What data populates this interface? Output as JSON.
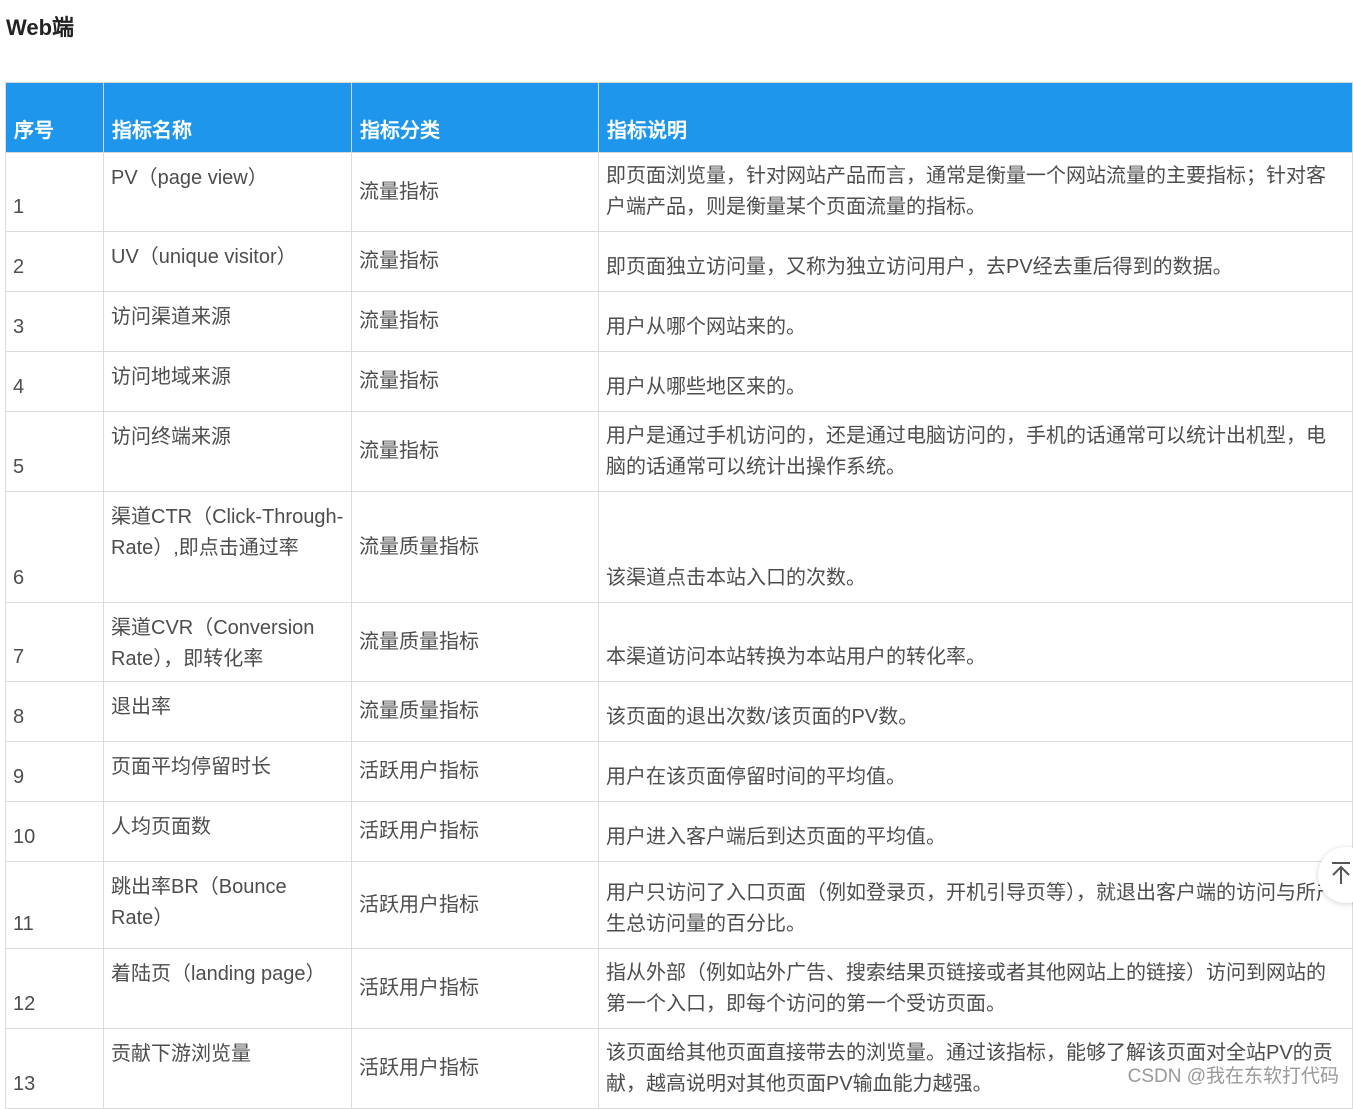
{
  "section_title": "Web端",
  "table": {
    "headers": [
      "序号",
      "指标名称",
      "指标分类",
      "指标说明"
    ],
    "rows": [
      {
        "seq": "1",
        "name": "PV（page view）",
        "category": "流量指标",
        "desc": "即页面浏览量，针对网站产品而言，通常是衡量一个网站流量的主要指标；针对客户端产品，则是衡量某个页面流量的指标。"
      },
      {
        "seq": "2",
        "name": "UV（unique visitor）",
        "category": "流量指标",
        "desc": "即页面独立访问量，又称为独立访问用户，去PV经去重后得到的数据。"
      },
      {
        "seq": "3",
        "name": "访问渠道来源",
        "category": "流量指标",
        "desc": "用户从哪个网站来的。"
      },
      {
        "seq": "4",
        "name": "访问地域来源",
        "category": "流量指标",
        "desc": "用户从哪些地区来的。"
      },
      {
        "seq": "5",
        "name": "访问终端来源",
        "category": "流量指标",
        "desc": "用户是通过手机访问的，还是通过电脑访问的，手机的话通常可以统计出机型，电脑的话通常可以统计出操作系统。"
      },
      {
        "seq": "6",
        "name": "渠道CTR（Click-Through-Rate）,即点击通过率",
        "category": "流量质量指标",
        "desc": "该渠道点击本站入口的次数。"
      },
      {
        "seq": "7",
        "name": "渠道CVR（Conversion Rate），即转化率",
        "category": "流量质量指标",
        "desc": "本渠道访问本站转换为本站用户的转化率。"
      },
      {
        "seq": "8",
        "name": "退出率",
        "category": "流量质量指标",
        "desc": "该页面的退出次数/该页面的PV数。"
      },
      {
        "seq": "9",
        "name": "页面平均停留时长",
        "category": "活跃用户指标",
        "desc": "用户在该页面停留时间的平均值。"
      },
      {
        "seq": "10",
        "name": "人均页面数",
        "category": "活跃用户指标",
        "desc": "用户进入客户端后到达页面的平均值。"
      },
      {
        "seq": "11",
        "name": "跳出率BR（Bounce Rate）",
        "category": "活跃用户指标",
        "desc": "用户只访问了入口页面（例如登录页，开机引导页等），就退出客户端的访问与所产生总访问量的百分比。"
      },
      {
        "seq": "12",
        "name": "着陆页（landing page）",
        "category": "活跃用户指标",
        "desc": "指从外部（例如站外广告、搜索结果页链接或者其他网站上的链接）访问到网站的第一个入口，即每个访问的第一个受访页面。"
      },
      {
        "seq": "13",
        "name": "贡献下游浏览量",
        "category": "活跃用户指标",
        "desc": "该页面给其他页面直接带去的浏览量。通过该指标，能够了解该页面对全站PV的贡献，越高说明对其他页面PV输血能力越强。"
      }
    ]
  },
  "watermark": "CSDN @我在东软打代码",
  "back_to_top_icon": "arrow-up-to-line-icon",
  "colors": {
    "header_bg": "#1d96ec",
    "header_text": "#ffffff",
    "border": "#dcdcdc"
  }
}
